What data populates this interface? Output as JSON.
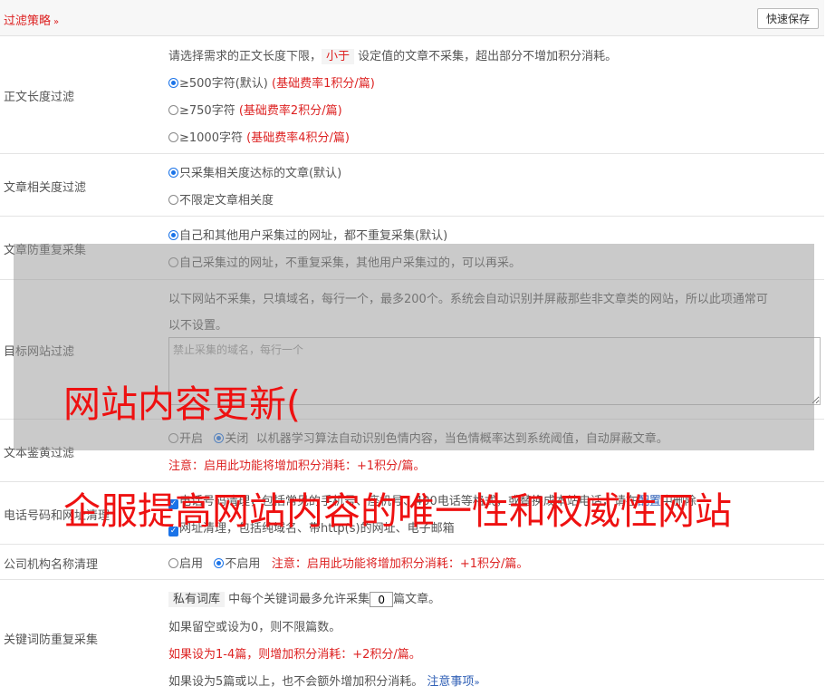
{
  "header": {
    "title": "过滤策略",
    "chevron": "»",
    "save_label": "快速保存"
  },
  "length_filter": {
    "label": "正文长度过滤",
    "desc_pre": "请选择需求的正文长度下限，",
    "desc_tag": "小于",
    "desc_post": "设定值的文章不采集，超出部分不增加积分消耗。",
    "options": [
      {
        "text": "≥500字符(默认)",
        "note": "(基础费率1积分/篇)"
      },
      {
        "text": "≥750字符",
        "note": "(基础费率2积分/篇)"
      },
      {
        "text": "≥1000字符",
        "note": "(基础费率4积分/篇)"
      }
    ]
  },
  "relevance": {
    "label": "文章相关度过滤",
    "options": [
      "只采集相关度达标的文章(默认)",
      "不限定文章相关度"
    ]
  },
  "dedupe": {
    "label": "文章防重复采集",
    "options": [
      "自己和其他用户采集过的网址，都不重复采集(默认)",
      "自己采集过的网址，不重复采集，其他用户采集过的，可以再采。"
    ]
  },
  "site_filter": {
    "label": "目标网站过滤",
    "desc_line1": "以下网站不采集，只填域名，每行一个，最多200个。系统会自动识别并屏蔽那些非文章类的网站，所以此项通常可",
    "desc_line2": "以不设置。",
    "placeholder": "禁止采集的域名，每行一个"
  },
  "porn_filter": {
    "label": "文本鉴黄过滤",
    "opt_on": "开启",
    "opt_off": "关闭",
    "desc": "以机器学习算法自动识别色情内容，当色情概率达到系统阈值，自动屏蔽文章。",
    "warning": "注意：启用此功能将增加积分消耗：+1积分/篇。"
  },
  "phone_url": {
    "label": "电话号码和网址清理",
    "line1": "电话号码清理，包括常见的手机号、座机号、400电话等格式，或替换成本站电话，请在",
    "link": "配置",
    "line1_end": "中删除",
    "line2": "网址清理，包括纯域名、带http(s)的网址、电子邮箱"
  },
  "company": {
    "label": "公司机构名称清理",
    "opt_on": "启用",
    "opt_off": "不启用",
    "warning": "注意：启用此功能将增加积分消耗：+1积分/篇。"
  },
  "keyword_dedupe": {
    "label": "关键词防重复采集",
    "tag": "私有词库",
    "line1_pre": "中每个关键词最多允许采集",
    "value": "0",
    "line1_post": "篇文章。",
    "line2": "如果留空或设为0，则不限篇数。",
    "line3": "如果设为1-4篇，则增加积分消耗：+2积分/篇。",
    "line4": "如果设为5篇或以上，也不会额外增加积分消耗。",
    "link": "注意事项",
    "link_chev": "»"
  },
  "watermark": {
    "line1": "网站内容更新(",
    "line2": "企服提高网站内容的唯一性和权威性网站"
  },
  "colors": {
    "accent": "#1a73e8",
    "warning": "#dd2222",
    "watermark": "#ee1111"
  }
}
